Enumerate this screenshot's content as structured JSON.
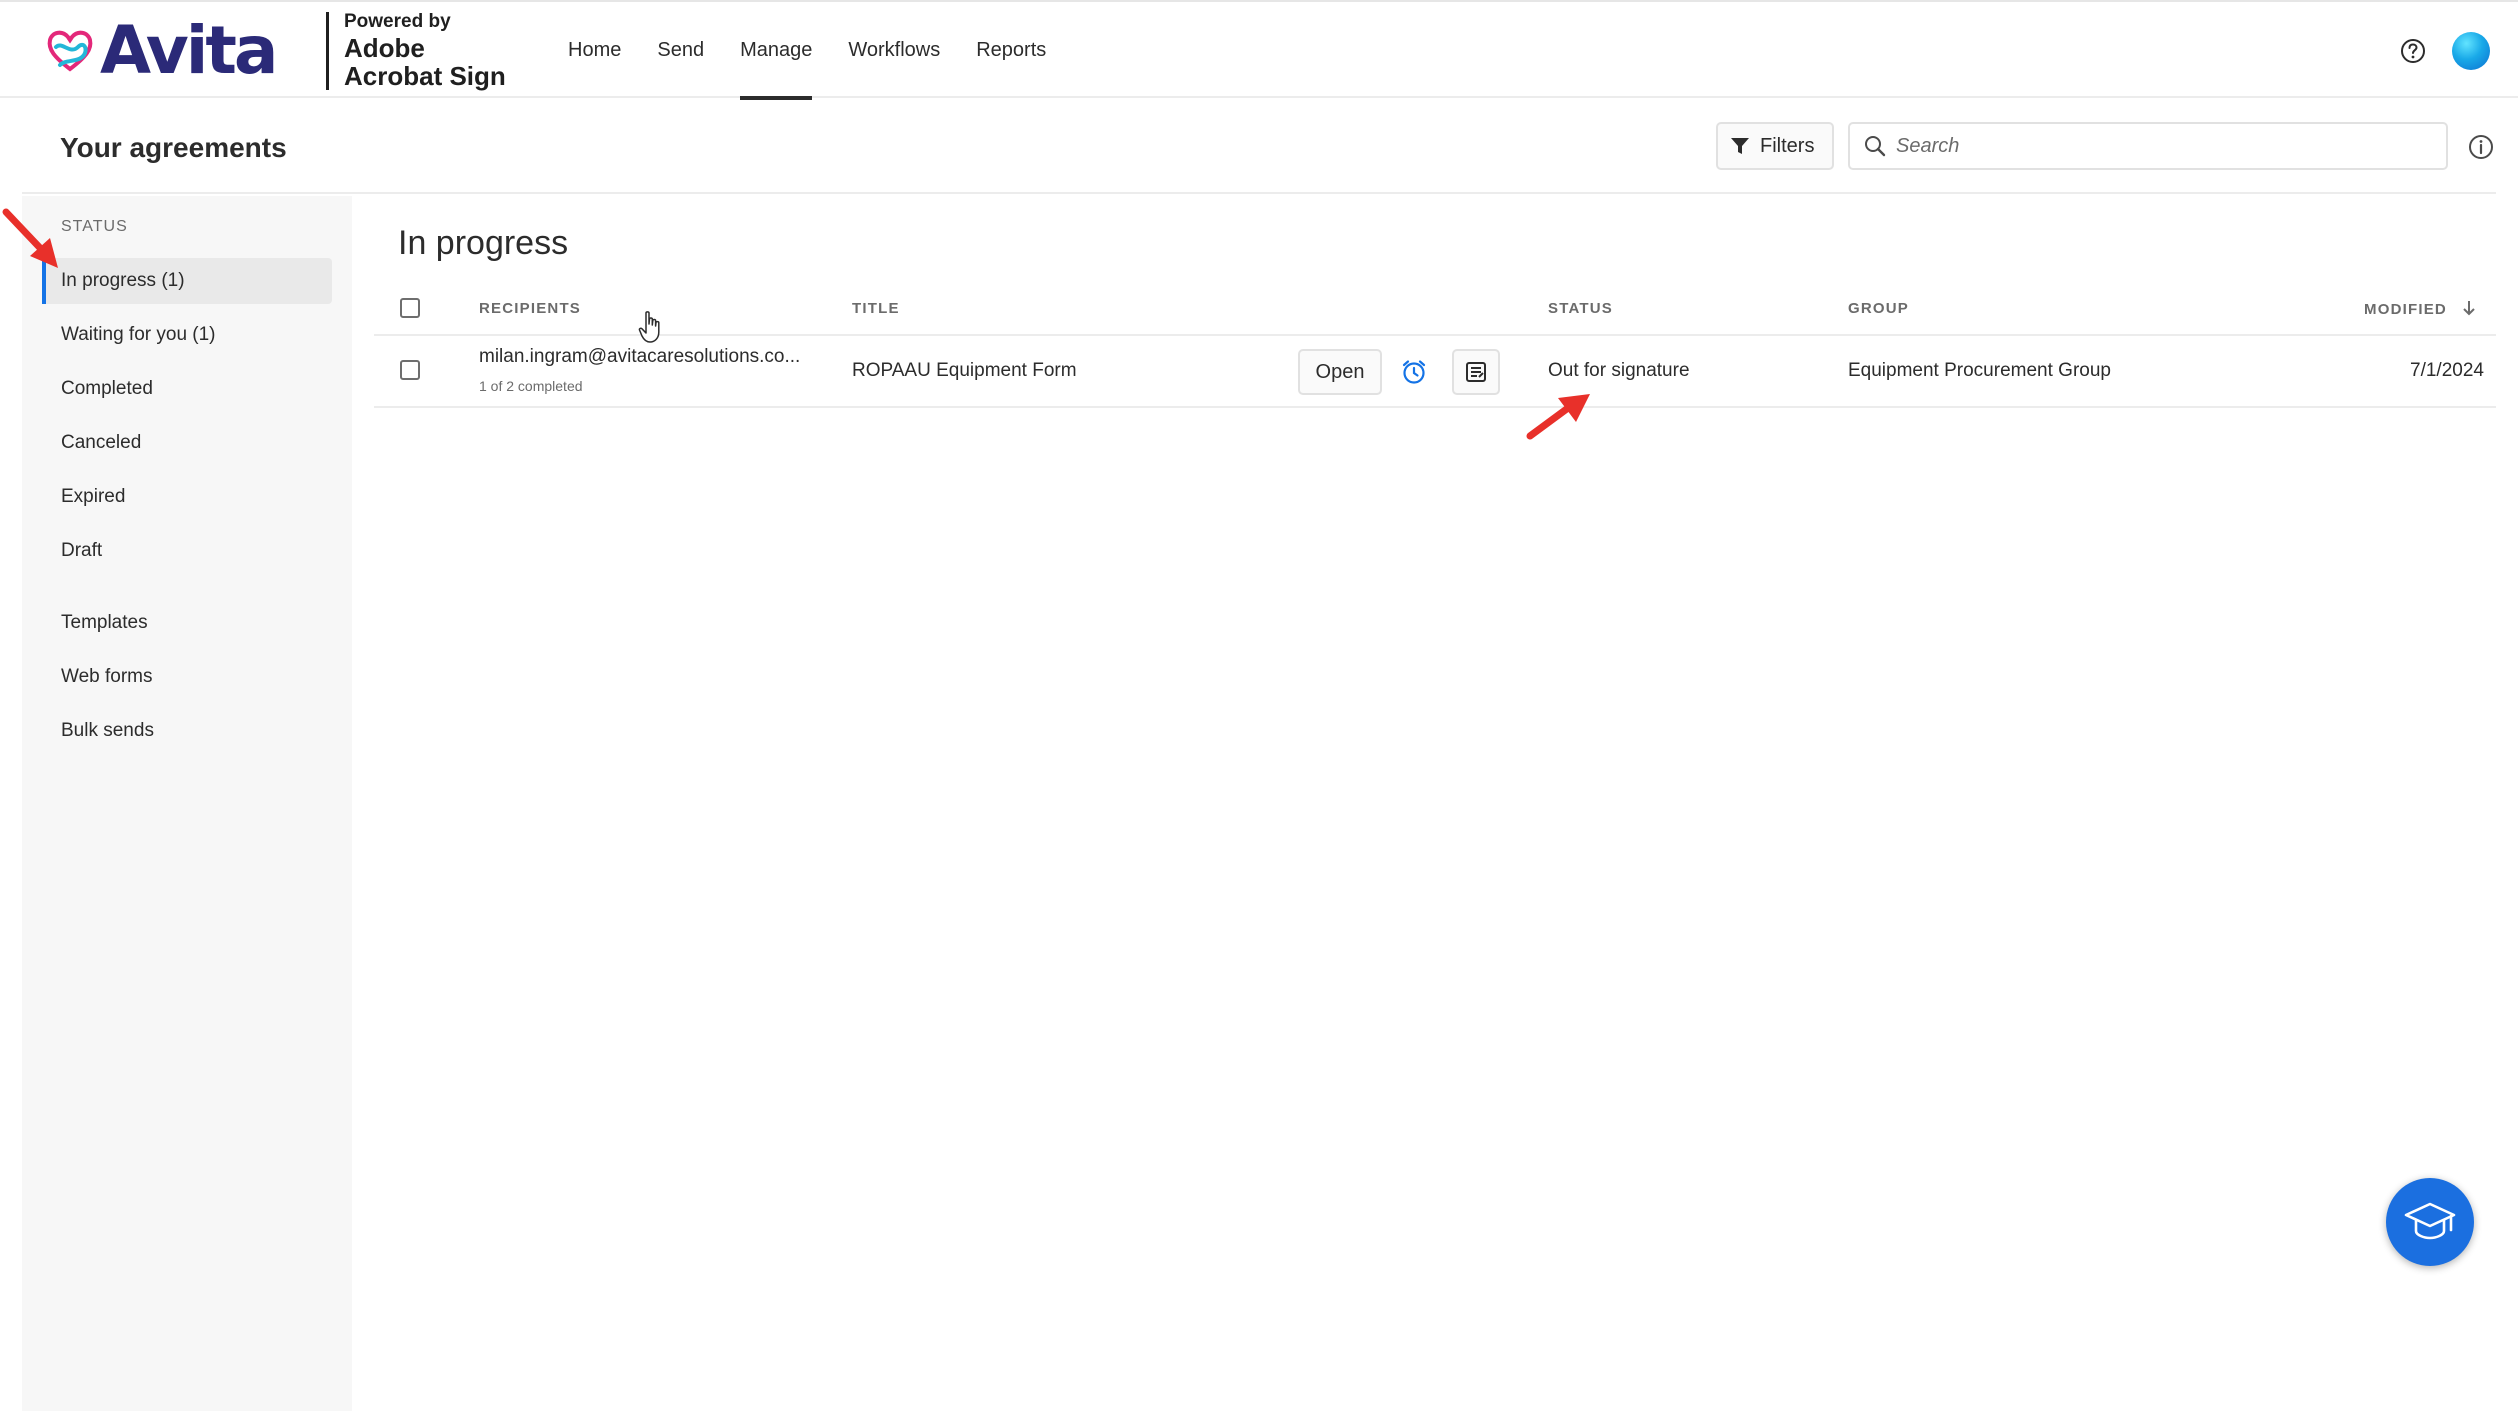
{
  "brand": {
    "name": "Avita",
    "powered_line1": "Powered by",
    "powered_line2": "Adobe",
    "powered_line3": "Acrobat Sign",
    "brand_color": "#2b2a78",
    "accent_color": "#1473e6"
  },
  "nav": {
    "items": [
      {
        "label": "Home"
      },
      {
        "label": "Send"
      },
      {
        "label": "Manage",
        "active": true
      },
      {
        "label": "Workflows"
      },
      {
        "label": "Reports"
      }
    ]
  },
  "header_icons": [
    "help-icon",
    "avatar"
  ],
  "subheader": {
    "title": "Your agreements",
    "filters_label": "Filters",
    "search_placeholder": "Search"
  },
  "sidebar": {
    "heading": "STATUS",
    "status_items": [
      {
        "label": "In progress (1)",
        "active": true
      },
      {
        "label": "Waiting for you (1)"
      },
      {
        "label": "Completed"
      },
      {
        "label": "Canceled"
      },
      {
        "label": "Expired"
      },
      {
        "label": "Draft"
      }
    ],
    "other_items": [
      {
        "label": "Templates"
      },
      {
        "label": "Web forms"
      },
      {
        "label": "Bulk sends"
      }
    ]
  },
  "main": {
    "title": "In progress",
    "columns": {
      "recipients": "RECIPIENTS",
      "title": "TITLE",
      "status": "STATUS",
      "group": "GROUP",
      "modified": "MODIFIED"
    },
    "rows": [
      {
        "recipient": "milan.ingram@avitacaresolutions.co...",
        "recipient_sub": "1 of 2 completed",
        "title": "ROPAAU Equipment Form",
        "open_label": "Open",
        "status": "Out for signature",
        "group": "Equipment Procurement Group",
        "modified": "7/1/2024"
      }
    ]
  },
  "annotation_color": "#e8302a"
}
